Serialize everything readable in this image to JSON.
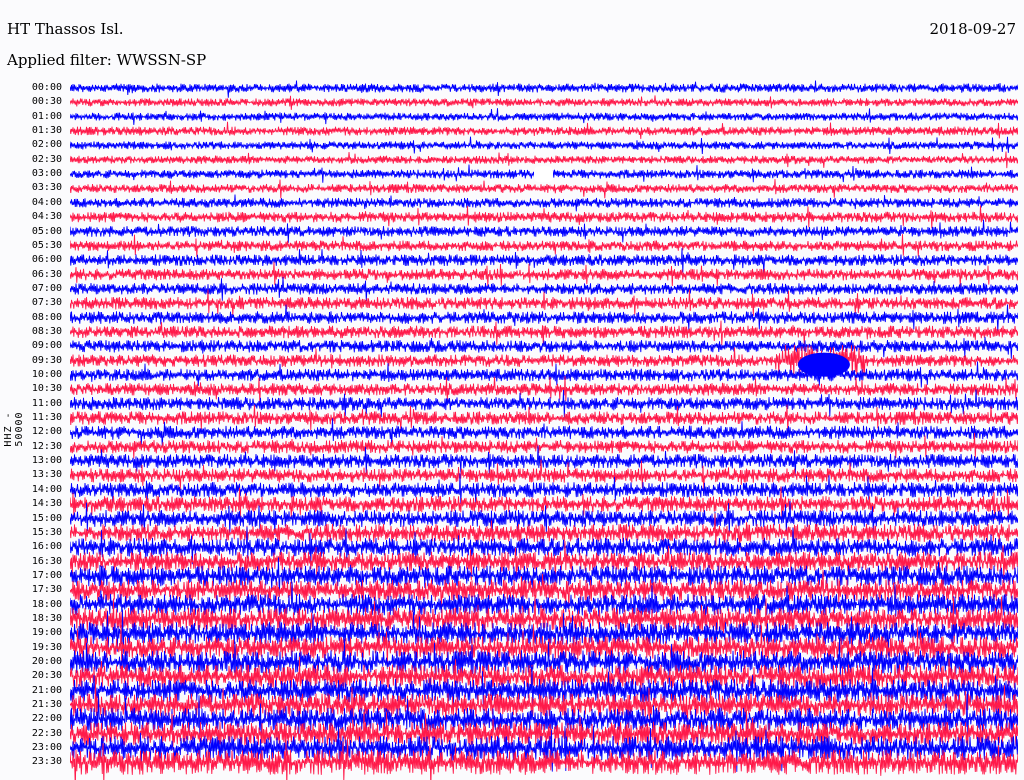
{
  "header": {
    "station": "HT Thassos Isl.",
    "date": "2018-09-27",
    "filter": "Applied filter: WWSSN-SP"
  },
  "chart_data": {
    "type": "line",
    "title": "HT Thassos Isl.",
    "subtitle": "Applied filter: WWSSN-SP",
    "ylabel": "HHZ - 50000",
    "xlabel": "",
    "row_labels": [
      "00:00",
      "00:30",
      "01:00",
      "01:30",
      "02:00",
      "02:30",
      "03:00",
      "03:30",
      "04:00",
      "04:30",
      "05:00",
      "05:30",
      "06:00",
      "06:30",
      "07:00",
      "07:30",
      "08:00",
      "08:30",
      "09:00",
      "09:30",
      "10:00",
      "10:30",
      "11:00",
      "11:30",
      "12:00",
      "12:30",
      "13:00",
      "13:30",
      "14:00",
      "14:30",
      "15:00",
      "15:30",
      "16:00",
      "16:30",
      "17:00",
      "17:30",
      "18:00",
      "18:30",
      "19:00",
      "19:30",
      "20:00",
      "20:30",
      "21:00",
      "21:30",
      "22:00",
      "22:30",
      "23:00",
      "23:30"
    ],
    "trace_colors": [
      "#0000ff",
      "#ff1a4a"
    ],
    "relative_noise_amplitude_by_row": [
      0.5,
      0.45,
      0.45,
      0.5,
      0.45,
      0.45,
      0.5,
      0.5,
      0.55,
      0.6,
      0.6,
      0.6,
      0.65,
      0.65,
      0.65,
      0.7,
      0.7,
      0.7,
      0.7,
      0.7,
      0.7,
      0.7,
      0.75,
      0.75,
      0.75,
      0.75,
      0.8,
      0.8,
      0.85,
      0.9,
      0.95,
      1.0,
      1.05,
      1.1,
      1.15,
      1.2,
      1.2,
      1.25,
      1.25,
      1.25,
      1.3,
      1.3,
      1.3,
      1.3,
      1.3,
      1.3,
      1.35,
      1.4
    ],
    "event": {
      "row_label": "09:30",
      "x_fraction": 0.79
    },
    "gap": {
      "row_label": "03:00",
      "x_fraction": 0.5
    }
  }
}
